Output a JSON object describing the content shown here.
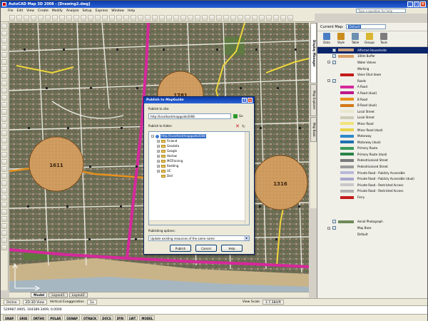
{
  "window": {
    "title": "AutoCAD Map 3D 2008 - [Drawing2.dwg]",
    "controls": [
      "_",
      "□",
      "×"
    ]
  },
  "menu": [
    "File",
    "Edit",
    "View",
    "Create",
    "Modify",
    "Analyze",
    "Setup",
    "Express",
    "Window",
    "Help"
  ],
  "help_search": {
    "placeholder": "Type a question for help"
  },
  "map_labels": {
    "circle1": "1611",
    "circle2": "1781",
    "circle3": "1316"
  },
  "layout_tabs": [
    "Model",
    "Layout1",
    "Layout2"
  ],
  "status_row": {
    "online": "Online",
    "view_mode": "2D-3D View",
    "vert_exag_label": "Vertical Exaggeration",
    "vert_exag_value": "1x",
    "view_scale_label": "View Scale",
    "view_scale_value": "1:7,384/ft"
  },
  "command_line": "529987.4905, 104389.3409, 0.0000",
  "status_toggles": [
    "SNAP",
    "GRID",
    "ORTHO",
    "POLAR",
    "OSNAP",
    "OTRACK",
    "DUCS",
    "DYN",
    "LWT",
    "MODEL"
  ],
  "panel": {
    "current_map_label": "Current Map:",
    "current_map_value": "Default",
    "tools": [
      {
        "label": "Data",
        "color": "#4a7ec4"
      },
      {
        "label": "Style",
        "color": "#c98d1e"
      },
      {
        "label": "Table",
        "color": "#6d8fb0"
      },
      {
        "label": "Groups",
        "color": "#d9b632"
      },
      {
        "label": "Tools",
        "color": "#7d7d7d"
      }
    ],
    "vertical_tabs": [
      "Display Manager",
      "Map Explorer",
      "Map Book"
    ],
    "legend": [
      {
        "label": "Affected Households",
        "swatch": "#c9a07a",
        "level": 0,
        "checked": true,
        "selected": true,
        "expander": ""
      },
      {
        "label": "100m Buffer",
        "swatch": "#d9a066",
        "level": 0,
        "checked": true,
        "selected": false,
        "expander": ""
      },
      {
        "label": "Water Valves",
        "swatch": "",
        "level": 0,
        "checked": true,
        "selected": false,
        "expander": "−"
      },
      {
        "label": "Working",
        "swatch": "",
        "level": 1,
        "checked": false,
        "selected": false,
        "expander": ""
      },
      {
        "label": "Valve Shut down",
        "swatch": "#c21a1a",
        "level": 1,
        "checked": false,
        "selected": false,
        "expander": ""
      },
      {
        "label": "Roads",
        "swatch": "",
        "level": 0,
        "checked": true,
        "selected": false,
        "expander": "−"
      },
      {
        "label": "A Road",
        "swatch": "#d6289c",
        "level": 1,
        "checked": false,
        "selected": false,
        "expander": ""
      },
      {
        "label": "A Road (dual)",
        "swatch": "#c0148a",
        "level": 1,
        "checked": false,
        "selected": false,
        "expander": ""
      },
      {
        "label": "B Road",
        "swatch": "#e7901d",
        "level": 1,
        "checked": false,
        "selected": false,
        "expander": ""
      },
      {
        "label": "B Road (dual)",
        "swatch": "#d2781a",
        "level": 1,
        "checked": false,
        "selected": false,
        "expander": ""
      },
      {
        "label": "Local Street",
        "swatch": "#e9e6cf",
        "level": 1,
        "checked": false,
        "selected": false,
        "expander": ""
      },
      {
        "label": "Local Street",
        "swatch": "#cdcbb6",
        "level": 1,
        "checked": false,
        "selected": false,
        "expander": ""
      },
      {
        "label": "Minor Road",
        "swatch": "#f2e37a",
        "level": 1,
        "checked": false,
        "selected": false,
        "expander": ""
      },
      {
        "label": "Minor Road (dual)",
        "swatch": "#e8d24a",
        "level": 1,
        "checked": false,
        "selected": false,
        "expander": ""
      },
      {
        "label": "Motorway",
        "swatch": "#2f88c8",
        "level": 1,
        "checked": false,
        "selected": false,
        "expander": ""
      },
      {
        "label": "Motorway (dual)",
        "swatch": "#1f6fb0",
        "level": 1,
        "checked": false,
        "selected": false,
        "expander": ""
      },
      {
        "label": "Primary Route",
        "swatch": "#3a9a5a",
        "level": 1,
        "checked": false,
        "selected": false,
        "expander": ""
      },
      {
        "label": "Primary Route (dual)",
        "swatch": "#2a8348",
        "level": 1,
        "checked": false,
        "selected": false,
        "expander": ""
      },
      {
        "label": "Pedestrianised Street",
        "swatch": "#7a7a7a",
        "level": 1,
        "checked": false,
        "selected": false,
        "expander": ""
      },
      {
        "label": "Pedestrianised Street",
        "swatch": "#9a9a9a",
        "level": 1,
        "checked": false,
        "selected": false,
        "expander": ""
      },
      {
        "label": "Private Road - Publicly Accessible",
        "swatch": "#b8b8d8",
        "level": 1,
        "checked": false,
        "selected": false,
        "expander": ""
      },
      {
        "label": "Private Road - Publicly Accessible (dual)",
        "swatch": "#a8a8cc",
        "level": 1,
        "checked": false,
        "selected": false,
        "expander": ""
      },
      {
        "label": "Private Road - Restricted Access",
        "swatch": "#c8c8c8",
        "level": 1,
        "checked": false,
        "selected": false,
        "expander": ""
      },
      {
        "label": "Private Road - Restricted Access",
        "swatch": "#b0b0b0",
        "level": 1,
        "checked": false,
        "selected": false,
        "expander": ""
      },
      {
        "label": "Ferry",
        "swatch": "#c21a1a",
        "level": 1,
        "checked": false,
        "selected": false,
        "expander": ""
      },
      {
        "label": "",
        "swatch": "",
        "level": 0,
        "checked": false,
        "selected": false,
        "expander": ""
      },
      {
        "label": "",
        "swatch": "",
        "level": 0,
        "checked": false,
        "selected": false,
        "expander": ""
      },
      {
        "label": "",
        "swatch": "",
        "level": 0,
        "checked": false,
        "selected": false,
        "expander": ""
      },
      {
        "label": "Aerial Photograph",
        "swatch": "#6e8a5a",
        "level": 0,
        "checked": true,
        "selected": false,
        "expander": ""
      },
      {
        "label": "Map Base",
        "swatch": "",
        "level": 0,
        "checked": true,
        "selected": false,
        "expander": "−"
      },
      {
        "label": "Default",
        "swatch": "",
        "level": 1,
        "checked": false,
        "selected": false,
        "expander": ""
      }
    ]
  },
  "dialog": {
    "title": "Publish to MapGuide",
    "site_label": "Publish to site:",
    "site_value": "http://localhost/mapguide2008",
    "go_label": "Go",
    "folder_label": "Publish to folder:",
    "tree": [
      {
        "label": "http://localhost/mapguide2008",
        "indent": 0,
        "kind": "globe",
        "selected": true,
        "expander": "−"
      },
      {
        "label": "Finland",
        "indent": 1,
        "kind": "folder",
        "selected": false,
        "expander": "+"
      },
      {
        "label": "Geodata",
        "indent": 1,
        "kind": "folder",
        "selected": false,
        "expander": "+"
      },
      {
        "label": "Google",
        "indent": 1,
        "kind": "folder",
        "selected": false,
        "expander": "+"
      },
      {
        "label": "Harlow",
        "indent": 1,
        "kind": "folder",
        "selected": false,
        "expander": "+"
      },
      {
        "label": "MGTraining",
        "indent": 1,
        "kind": "folder",
        "selected": false,
        "expander": "+"
      },
      {
        "label": "Redding",
        "indent": 1,
        "kind": "folder",
        "selected": false,
        "expander": "+"
      },
      {
        "label": "UC",
        "indent": 1,
        "kind": "folder",
        "selected": false,
        "expander": "+"
      },
      {
        "label": "Dell",
        "indent": 1,
        "kind": "folder",
        "selected": false,
        "expander": ""
      }
    ],
    "options_label": "Publishing options:",
    "options_value": "Update existing resources of the same name",
    "buttons": [
      "Publish",
      "Cancel",
      "Help"
    ]
  }
}
